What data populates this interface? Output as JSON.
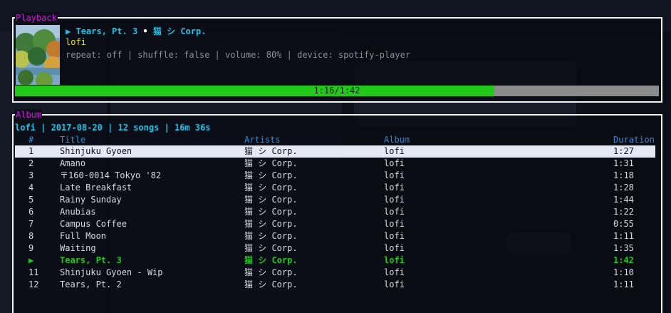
{
  "playback": {
    "box_title": "Playback",
    "play_symbol": "▶",
    "track": "Tears, Pt. 3",
    "separator": "•",
    "artist": "猫 シ Corp.",
    "album": "lofi",
    "status": "repeat: off | shuffle: false | volume: 80% | device: spotify-player",
    "progress_fraction": 0.744,
    "progress_label": "1:16/1:42"
  },
  "album": {
    "box_title": "Album",
    "header": "lofi | 2017-08-20 | 12 songs | 16m 36s",
    "columns": [
      "#",
      "Title",
      "Artists",
      "Album",
      "Duration"
    ],
    "tracks": [
      {
        "num": "1",
        "title": "Shinjuku Gyoen",
        "artist": "猫 シ Corp.",
        "album": "lofi",
        "duration": "1:27"
      },
      {
        "num": "2",
        "title": "Amano",
        "artist": "猫 シ Corp.",
        "album": "lofi",
        "duration": "1:31"
      },
      {
        "num": "3",
        "title": "〒160-0014 Tokyo '82",
        "artist": "猫 シ Corp.",
        "album": "lofi",
        "duration": "1:18"
      },
      {
        "num": "4",
        "title": "Late Breakfast",
        "artist": "猫 シ Corp.",
        "album": "lofi",
        "duration": "1:28"
      },
      {
        "num": "5",
        "title": "Rainy Sunday",
        "artist": "猫 シ Corp.",
        "album": "lofi",
        "duration": "1:44"
      },
      {
        "num": "6",
        "title": "Anubias",
        "artist": "猫 シ Corp.",
        "album": "lofi",
        "duration": "1:22"
      },
      {
        "num": "7",
        "title": "Campus Coffee",
        "artist": "猫 シ Corp.",
        "album": "lofi",
        "duration": "0:55"
      },
      {
        "num": "8",
        "title": "Full Moon",
        "artist": "猫 シ Corp.",
        "album": "lofi",
        "duration": "1:11"
      },
      {
        "num": "9",
        "title": "Waiting",
        "artist": "猫 シ Corp.",
        "album": "lofi",
        "duration": "1:35"
      },
      {
        "num": "▶",
        "title": "Tears, Pt. 3",
        "artist": "猫 シ Corp.",
        "album": "lofi",
        "duration": "1:42"
      },
      {
        "num": "11",
        "title": "Shinjuku Gyoen - Wip",
        "artist": "猫 シ Corp.",
        "album": "lofi",
        "duration": "1:10"
      },
      {
        "num": "12",
        "title": "Tears, Pt. 2",
        "artist": "猫 シ Corp.",
        "album": "lofi",
        "duration": "1:11"
      }
    ],
    "selected_index": 0,
    "playing_index": 9
  },
  "colors": {
    "border": "#f2f2f2",
    "box_title": "#c61ed4",
    "track": "#1ec3e8",
    "album": "#e3e33a",
    "progress_fill": "#22c81a",
    "progress_bg": "#8c8c8c",
    "header": "#2b8de0",
    "selected_bg": "#e4e9f4"
  }
}
